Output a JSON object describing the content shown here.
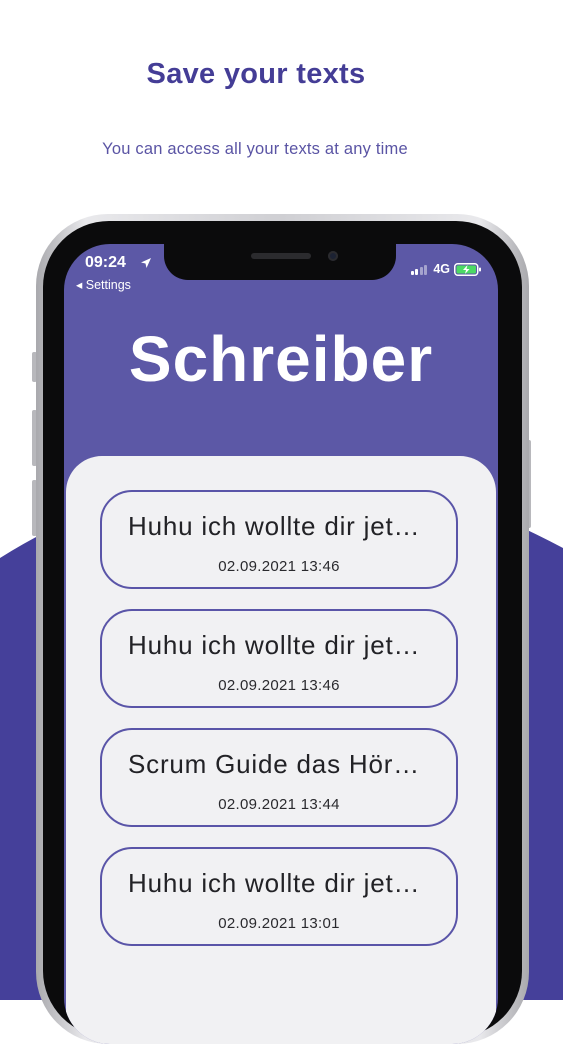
{
  "headline": "Save your texts",
  "subline": "You can access all your texts at any time",
  "status_bar": {
    "time": "09:24",
    "back_label": "◂ Settings",
    "network": "4G"
  },
  "app": {
    "title": "Schreiber"
  },
  "notes": [
    {
      "title": "Huhu ich wollte dir jet…",
      "date": "02.09.2021 13:46"
    },
    {
      "title": "Huhu ich wollte dir jet…",
      "date": "02.09.2021 13:46"
    },
    {
      "title": "Scrum Guide das Hör…",
      "date": "02.09.2021 13:44"
    },
    {
      "title": "Huhu ich wollte dir jet…",
      "date": "02.09.2021 13:01"
    }
  ],
  "colors": {
    "accent": "#443d96",
    "header_bg": "#5c58a6",
    "card_border": "#5a55a8",
    "battery": "#4cd964"
  },
  "icons": [
    "location-arrow-icon",
    "signal-bars-icon",
    "battery-charging-icon"
  ]
}
